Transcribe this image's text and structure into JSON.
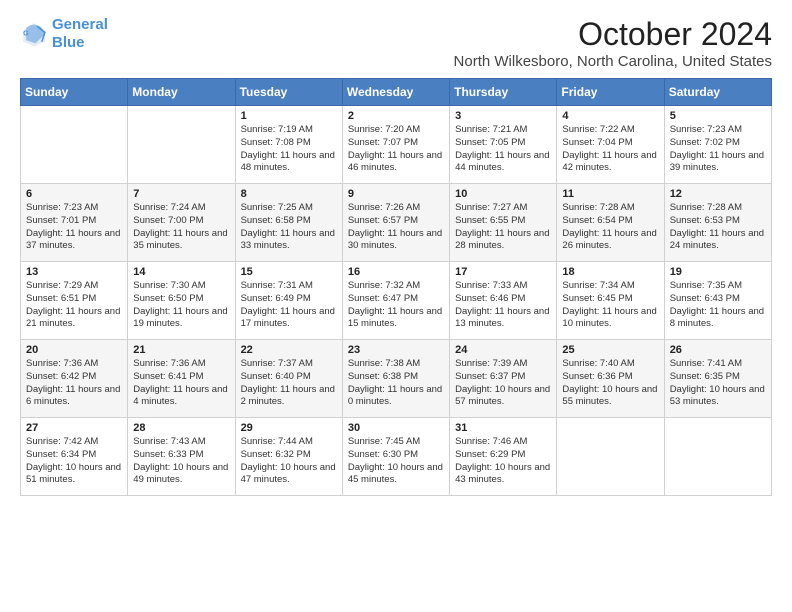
{
  "logo": {
    "line1": "General",
    "line2": "Blue"
  },
  "title": "October 2024",
  "subtitle": "North Wilkesboro, North Carolina, United States",
  "days_of_week": [
    "Sunday",
    "Monday",
    "Tuesday",
    "Wednesday",
    "Thursday",
    "Friday",
    "Saturday"
  ],
  "weeks": [
    [
      {
        "day": "",
        "info": ""
      },
      {
        "day": "",
        "info": ""
      },
      {
        "day": "1",
        "info": "Sunrise: 7:19 AM\nSunset: 7:08 PM\nDaylight: 11 hours and 48 minutes."
      },
      {
        "day": "2",
        "info": "Sunrise: 7:20 AM\nSunset: 7:07 PM\nDaylight: 11 hours and 46 minutes."
      },
      {
        "day": "3",
        "info": "Sunrise: 7:21 AM\nSunset: 7:05 PM\nDaylight: 11 hours and 44 minutes."
      },
      {
        "day": "4",
        "info": "Sunrise: 7:22 AM\nSunset: 7:04 PM\nDaylight: 11 hours and 42 minutes."
      },
      {
        "day": "5",
        "info": "Sunrise: 7:23 AM\nSunset: 7:02 PM\nDaylight: 11 hours and 39 minutes."
      }
    ],
    [
      {
        "day": "6",
        "info": "Sunrise: 7:23 AM\nSunset: 7:01 PM\nDaylight: 11 hours and 37 minutes."
      },
      {
        "day": "7",
        "info": "Sunrise: 7:24 AM\nSunset: 7:00 PM\nDaylight: 11 hours and 35 minutes."
      },
      {
        "day": "8",
        "info": "Sunrise: 7:25 AM\nSunset: 6:58 PM\nDaylight: 11 hours and 33 minutes."
      },
      {
        "day": "9",
        "info": "Sunrise: 7:26 AM\nSunset: 6:57 PM\nDaylight: 11 hours and 30 minutes."
      },
      {
        "day": "10",
        "info": "Sunrise: 7:27 AM\nSunset: 6:55 PM\nDaylight: 11 hours and 28 minutes."
      },
      {
        "day": "11",
        "info": "Sunrise: 7:28 AM\nSunset: 6:54 PM\nDaylight: 11 hours and 26 minutes."
      },
      {
        "day": "12",
        "info": "Sunrise: 7:28 AM\nSunset: 6:53 PM\nDaylight: 11 hours and 24 minutes."
      }
    ],
    [
      {
        "day": "13",
        "info": "Sunrise: 7:29 AM\nSunset: 6:51 PM\nDaylight: 11 hours and 21 minutes."
      },
      {
        "day": "14",
        "info": "Sunrise: 7:30 AM\nSunset: 6:50 PM\nDaylight: 11 hours and 19 minutes."
      },
      {
        "day": "15",
        "info": "Sunrise: 7:31 AM\nSunset: 6:49 PM\nDaylight: 11 hours and 17 minutes."
      },
      {
        "day": "16",
        "info": "Sunrise: 7:32 AM\nSunset: 6:47 PM\nDaylight: 11 hours and 15 minutes."
      },
      {
        "day": "17",
        "info": "Sunrise: 7:33 AM\nSunset: 6:46 PM\nDaylight: 11 hours and 13 minutes."
      },
      {
        "day": "18",
        "info": "Sunrise: 7:34 AM\nSunset: 6:45 PM\nDaylight: 11 hours and 10 minutes."
      },
      {
        "day": "19",
        "info": "Sunrise: 7:35 AM\nSunset: 6:43 PM\nDaylight: 11 hours and 8 minutes."
      }
    ],
    [
      {
        "day": "20",
        "info": "Sunrise: 7:36 AM\nSunset: 6:42 PM\nDaylight: 11 hours and 6 minutes."
      },
      {
        "day": "21",
        "info": "Sunrise: 7:36 AM\nSunset: 6:41 PM\nDaylight: 11 hours and 4 minutes."
      },
      {
        "day": "22",
        "info": "Sunrise: 7:37 AM\nSunset: 6:40 PM\nDaylight: 11 hours and 2 minutes."
      },
      {
        "day": "23",
        "info": "Sunrise: 7:38 AM\nSunset: 6:38 PM\nDaylight: 11 hours and 0 minutes."
      },
      {
        "day": "24",
        "info": "Sunrise: 7:39 AM\nSunset: 6:37 PM\nDaylight: 10 hours and 57 minutes."
      },
      {
        "day": "25",
        "info": "Sunrise: 7:40 AM\nSunset: 6:36 PM\nDaylight: 10 hours and 55 minutes."
      },
      {
        "day": "26",
        "info": "Sunrise: 7:41 AM\nSunset: 6:35 PM\nDaylight: 10 hours and 53 minutes."
      }
    ],
    [
      {
        "day": "27",
        "info": "Sunrise: 7:42 AM\nSunset: 6:34 PM\nDaylight: 10 hours and 51 minutes."
      },
      {
        "day": "28",
        "info": "Sunrise: 7:43 AM\nSunset: 6:33 PM\nDaylight: 10 hours and 49 minutes."
      },
      {
        "day": "29",
        "info": "Sunrise: 7:44 AM\nSunset: 6:32 PM\nDaylight: 10 hours and 47 minutes."
      },
      {
        "day": "30",
        "info": "Sunrise: 7:45 AM\nSunset: 6:30 PM\nDaylight: 10 hours and 45 minutes."
      },
      {
        "day": "31",
        "info": "Sunrise: 7:46 AM\nSunset: 6:29 PM\nDaylight: 10 hours and 43 minutes."
      },
      {
        "day": "",
        "info": ""
      },
      {
        "day": "",
        "info": ""
      }
    ]
  ]
}
